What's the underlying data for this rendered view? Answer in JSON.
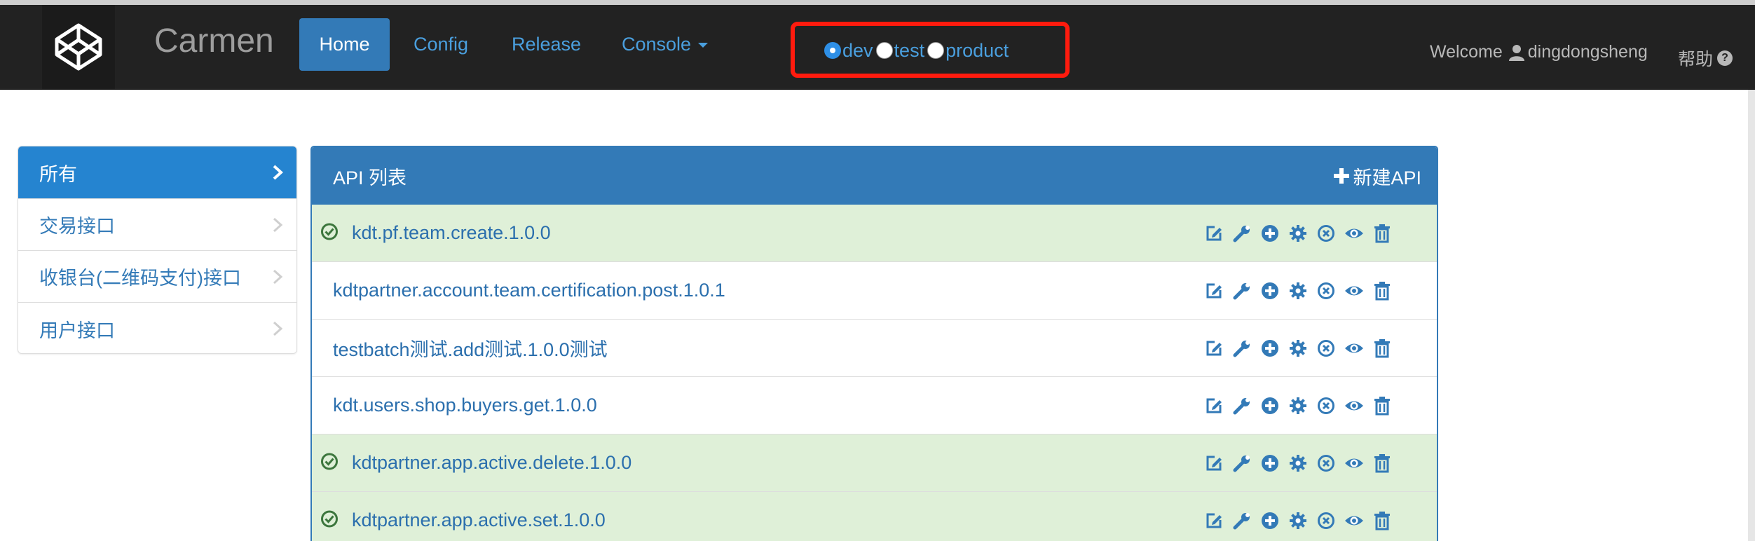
{
  "nav": {
    "brand": "Carmen",
    "links": [
      {
        "label": "Home",
        "active": true
      },
      {
        "label": "Config"
      },
      {
        "label": "Release"
      },
      {
        "label": "Console"
      }
    ],
    "env_options": [
      {
        "label": "dev",
        "selected": true
      },
      {
        "label": "test",
        "selected": false
      },
      {
        "label": "product",
        "selected": false
      }
    ],
    "welcome_prefix": "Welcome",
    "username": "dingdongsheng",
    "help_label": "帮助"
  },
  "sidebar": {
    "items": [
      {
        "label": "所有",
        "active": true
      },
      {
        "label": "交易接口"
      },
      {
        "label": "收银台(二维码支付)接口"
      },
      {
        "label": "用户接口"
      }
    ]
  },
  "panel": {
    "title": "API 列表",
    "new_button_label": "新建API",
    "rows": [
      {
        "name": "kdt.pf.team.create.1.0.0",
        "status": "ok"
      },
      {
        "name": "kdtpartner.account.team.certification.post.1.0.1",
        "status": "none"
      },
      {
        "name": "testbatch测试.add测试.1.0.0测试",
        "status": "none"
      },
      {
        "name": "kdt.users.shop.buyers.get.1.0.0",
        "status": "none"
      },
      {
        "name": "kdtpartner.app.active.delete.1.0.0",
        "status": "ok"
      },
      {
        "name": "kdtpartner.app.active.set.1.0.0",
        "status": "ok"
      }
    ],
    "row_actions": [
      "edit-icon",
      "wrench-icon",
      "plus-circle-icon",
      "gear-icon",
      "remove-circle-icon",
      "eye-icon",
      "trash-icon"
    ]
  },
  "colors": {
    "navbar_bg": "#222222",
    "primary": "#337ab7",
    "link": "#4a9fde",
    "success_row_bg": "#dff0d8",
    "success_icon": "#3c763d",
    "highlight_border": "#ff1b0e"
  }
}
